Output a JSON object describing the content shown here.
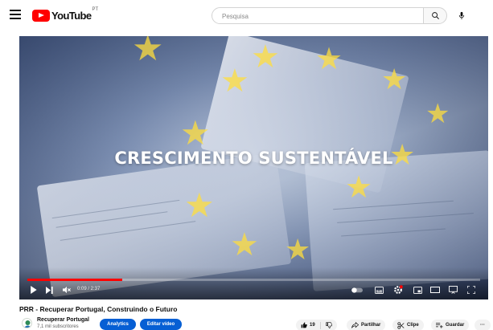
{
  "header": {
    "logo_text": "YouTube",
    "logo_country": "PT",
    "search_placeholder": "Pesquisa"
  },
  "player": {
    "overlay_title": "CRESCIMENTO SUSTENTÁVEL",
    "time": "0:09 / 2:37",
    "progress": 0.21
  },
  "video": {
    "title": "PRR - Recuperar Portugal, Construindo o Futuro",
    "channel": "Recuperar Portugal",
    "subscribers": "7,1 mil subscritores",
    "likes": "19",
    "analytics_label": "Analytics",
    "edit_label": "Editar vídeo",
    "share_label": "Partilhar",
    "clip_label": "Clipe",
    "save_label": "Guardar",
    "more_label": "···"
  },
  "colors": {
    "brand": "#ff0000",
    "primary_button": "#065fd4",
    "chip_bg": "#f2f2f2"
  },
  "icons": [
    "menu-icon",
    "youtube-logo-icon",
    "search-icon",
    "mic-icon",
    "play-icon",
    "next-icon",
    "mute-icon",
    "autoplay-icon",
    "subtitles-icon",
    "settings-icon",
    "miniplayer-icon",
    "theater-icon",
    "cast-icon",
    "fullscreen-icon",
    "like-icon",
    "dislike-icon",
    "share-icon",
    "clip-icon",
    "save-icon"
  ]
}
